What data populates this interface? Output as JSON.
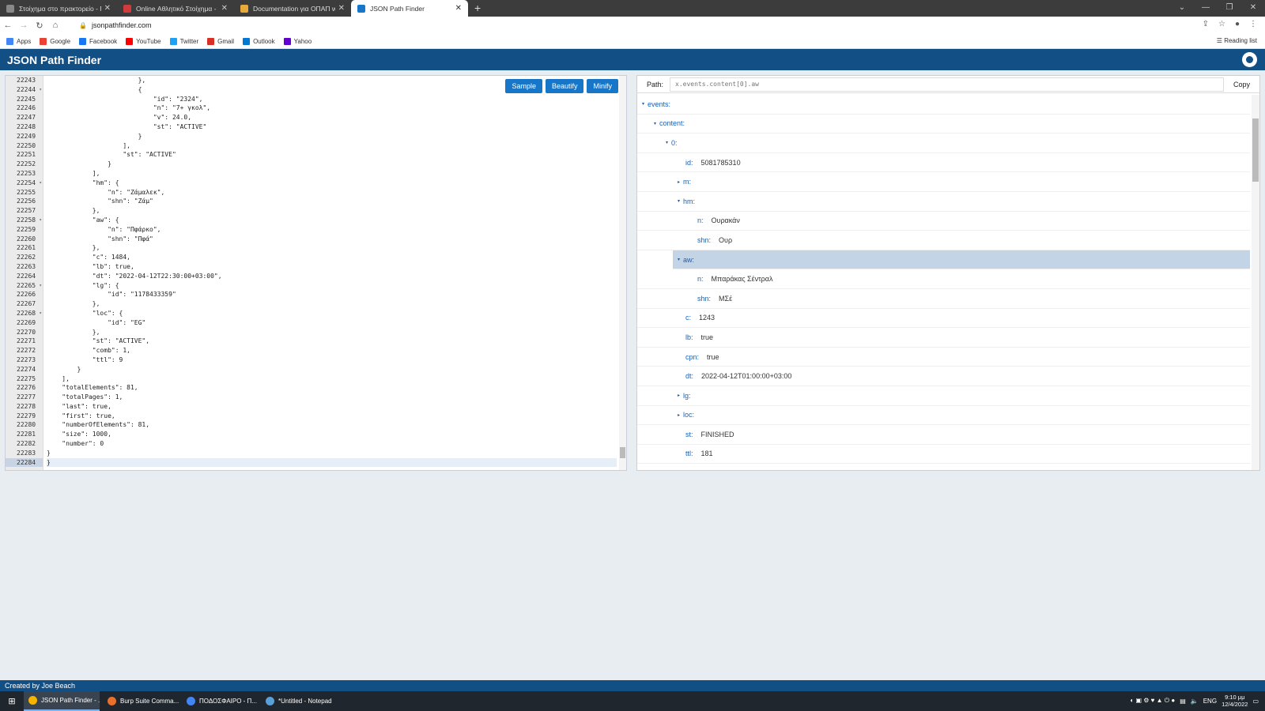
{
  "browser": {
    "tabs": [
      {
        "title": "Στοίχημα στο πρακτορείο - ΠΑΜ",
        "icon": "opap-icon",
        "color": "#888888"
      },
      {
        "title": "Online Αθλητικό Στοίχημα - Live",
        "icon": "stoiximan-icon",
        "color": "#d23b3b"
      },
      {
        "title": "Documentation για ΟΠΑΠ web s",
        "icon": "docs-icon",
        "color": "#e8a93b"
      },
      {
        "title": "JSON Path Finder",
        "icon": "jsonpath-icon",
        "color": "#1876c8"
      }
    ],
    "new_tab": "+",
    "url": "jsonpathfinder.com",
    "reading_list": "Reading list",
    "bookmarks": [
      {
        "label": "Apps",
        "icon": "apps-grid-icon",
        "color": "#4285f4"
      },
      {
        "label": "Google",
        "icon": "google-icon",
        "color": "#ea4335"
      },
      {
        "label": "Facebook",
        "icon": "facebook-icon",
        "color": "#1877f2"
      },
      {
        "label": "YouTube",
        "icon": "youtube-icon",
        "color": "#ff0000"
      },
      {
        "label": "Twitter",
        "icon": "twitter-icon",
        "color": "#1da1f2"
      },
      {
        "label": "Gmail",
        "icon": "gmail-icon",
        "color": "#d93025"
      },
      {
        "label": "Outlook",
        "icon": "outlook-icon",
        "color": "#0078d4"
      },
      {
        "label": "Yahoo",
        "icon": "yahoo-icon",
        "color": "#6001d2"
      }
    ]
  },
  "app": {
    "title": "JSON Path Finder",
    "footer": "Created by Joe Beach",
    "buttons": {
      "sample": "Sample",
      "beautify": "Beautify",
      "minify": "Minify"
    },
    "accent": "#124f85"
  },
  "editor": {
    "lines": [
      {
        "no": "22243",
        "text": "                        },",
        "fold": false
      },
      {
        "no": "22244",
        "text": "                        {",
        "fold": true
      },
      {
        "no": "22245",
        "text": "                            \"id\": \"2324\",",
        "fold": false
      },
      {
        "no": "22246",
        "text": "                            \"n\": \"7+ γκολ\",",
        "fold": false
      },
      {
        "no": "22247",
        "text": "                            \"v\": 24.0,",
        "fold": false
      },
      {
        "no": "22248",
        "text": "                            \"st\": \"ACTIVE\"",
        "fold": false
      },
      {
        "no": "22249",
        "text": "                        }",
        "fold": false
      },
      {
        "no": "22250",
        "text": "                    ],",
        "fold": false
      },
      {
        "no": "22251",
        "text": "                    \"st\": \"ACTIVE\"",
        "fold": false
      },
      {
        "no": "22252",
        "text": "                }",
        "fold": false
      },
      {
        "no": "22253",
        "text": "            ],",
        "fold": false
      },
      {
        "no": "22254",
        "text": "            \"hm\": {",
        "fold": true
      },
      {
        "no": "22255",
        "text": "                \"n\": \"Ζάμαλεκ\",",
        "fold": false
      },
      {
        "no": "22256",
        "text": "                \"shn\": \"Ζάμ\"",
        "fold": false
      },
      {
        "no": "22257",
        "text": "            },",
        "fold": false
      },
      {
        "no": "22258",
        "text": "            \"aw\": {",
        "fold": true
      },
      {
        "no": "22259",
        "text": "                \"n\": \"Πφάρκο\",",
        "fold": false
      },
      {
        "no": "22260",
        "text": "                \"shn\": \"Πφά\"",
        "fold": false
      },
      {
        "no": "22261",
        "text": "            },",
        "fold": false
      },
      {
        "no": "22262",
        "text": "            \"c\": 1484,",
        "fold": false
      },
      {
        "no": "22263",
        "text": "            \"lb\": true,",
        "fold": false
      },
      {
        "no": "22264",
        "text": "            \"dt\": \"2022-04-12T22:30:00+03:00\",",
        "fold": false
      },
      {
        "no": "22265",
        "text": "            \"lg\": {",
        "fold": true
      },
      {
        "no": "22266",
        "text": "                \"id\": \"1178433359\"",
        "fold": false
      },
      {
        "no": "22267",
        "text": "            },",
        "fold": false
      },
      {
        "no": "22268",
        "text": "            \"loc\": {",
        "fold": true
      },
      {
        "no": "22269",
        "text": "                \"id\": \"EG\"",
        "fold": false
      },
      {
        "no": "22270",
        "text": "            },",
        "fold": false
      },
      {
        "no": "22271",
        "text": "            \"st\": \"ACTIVE\",",
        "fold": false
      },
      {
        "no": "22272",
        "text": "            \"comb\": 1,",
        "fold": false
      },
      {
        "no": "22273",
        "text": "            \"ttl\": 9",
        "fold": false
      },
      {
        "no": "22274",
        "text": "        }",
        "fold": false
      },
      {
        "no": "22275",
        "text": "    ],",
        "fold": false
      },
      {
        "no": "22276",
        "text": "    \"totalElements\": 81,",
        "fold": false
      },
      {
        "no": "22277",
        "text": "    \"totalPages\": 1,",
        "fold": false
      },
      {
        "no": "22278",
        "text": "    \"last\": true,",
        "fold": false
      },
      {
        "no": "22279",
        "text": "    \"first\": true,",
        "fold": false
      },
      {
        "no": "22280",
        "text": "    \"numberOfElements\": 81,",
        "fold": false
      },
      {
        "no": "22281",
        "text": "    \"size\": 1000,",
        "fold": false
      },
      {
        "no": "22282",
        "text": "    \"number\": 0",
        "fold": false
      },
      {
        "no": "22283",
        "text": "}",
        "fold": false
      },
      {
        "no": "22284",
        "text": "}",
        "fold": false
      }
    ]
  },
  "path_panel": {
    "label": "Path:",
    "value": "x.events.content[0].aw",
    "copy": "Copy",
    "tree": [
      {
        "key": "events:",
        "value": "",
        "level": 0,
        "arrow": "▾",
        "selected": false
      },
      {
        "key": "content:",
        "value": "",
        "level": 1,
        "arrow": "▾",
        "selected": false
      },
      {
        "key": "0:",
        "value": "",
        "level": 2,
        "arrow": "▾",
        "selected": false
      },
      {
        "key": "id:",
        "value": "5081785310",
        "level": 3,
        "arrow": "",
        "selected": false
      },
      {
        "key": "m:",
        "value": "",
        "level": 3,
        "arrow": "▸",
        "selected": false
      },
      {
        "key": "hm:",
        "value": "",
        "level": 3,
        "arrow": "▾",
        "selected": false
      },
      {
        "key": "n:",
        "value": "Ουρακάν",
        "level": 4,
        "arrow": "",
        "selected": false
      },
      {
        "key": "shn:",
        "value": "Ουρ",
        "level": 4,
        "arrow": "",
        "selected": false
      },
      {
        "key": "aw:",
        "value": "",
        "level": 3,
        "arrow": "▾",
        "selected": true
      },
      {
        "key": "n:",
        "value": "Μπαράκας Σέντραλ",
        "level": 4,
        "arrow": "",
        "selected": false
      },
      {
        "key": "shn:",
        "value": "ΜΣέ",
        "level": 4,
        "arrow": "",
        "selected": false
      },
      {
        "key": "c:",
        "value": "1243",
        "level": 3,
        "arrow": "",
        "selected": false
      },
      {
        "key": "lb:",
        "value": "true",
        "level": 3,
        "arrow": "",
        "selected": false
      },
      {
        "key": "cpn:",
        "value": "true",
        "level": 3,
        "arrow": "",
        "selected": false
      },
      {
        "key": "dt:",
        "value": "2022-04-12T01:00:00+03:00",
        "level": 3,
        "arrow": "",
        "selected": false
      },
      {
        "key": "lg:",
        "value": "",
        "level": 3,
        "arrow": "▸",
        "selected": false
      },
      {
        "key": "loc:",
        "value": "",
        "level": 3,
        "arrow": "▸",
        "selected": false
      },
      {
        "key": "st:",
        "value": "FINISHED",
        "level": 3,
        "arrow": "",
        "selected": false
      },
      {
        "key": "ttl:",
        "value": "181",
        "level": 3,
        "arrow": "",
        "selected": false
      }
    ]
  },
  "taskbar": {
    "items": [
      {
        "label": "JSON Path Finder - ...",
        "icon": "chrome-icon",
        "color": "#f4b400",
        "active": true
      },
      {
        "label": "Burp Suite Comma...",
        "icon": "burp-icon",
        "color": "#e8702a",
        "active": false
      },
      {
        "label": "ΠΟΔΟΣΦΑΙΡΟ - Π...",
        "icon": "chrome-icon",
        "color": "#4285f4",
        "active": false
      },
      {
        "label": "*Untitled - Notepad",
        "icon": "notepad-icon",
        "color": "#5aa0d8",
        "active": false
      }
    ],
    "lang": "ENG",
    "time": "9:10 μμ",
    "date": "12/4/2022"
  }
}
